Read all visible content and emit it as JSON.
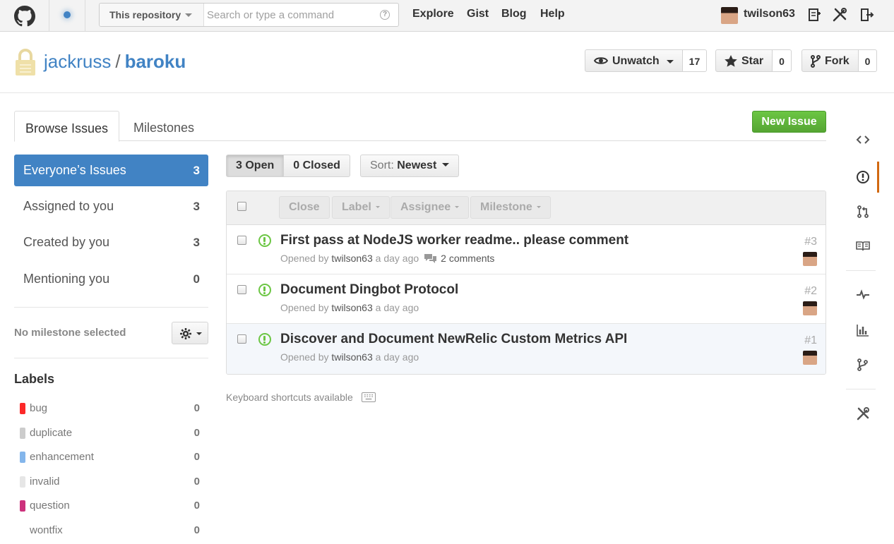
{
  "header": {
    "search_scope": "This repository",
    "search_placeholder": "Search or type a command",
    "nav": [
      "Explore",
      "Gist",
      "Blog",
      "Help"
    ],
    "username": "twilson63"
  },
  "repo": {
    "owner": "jackruss",
    "separator": "/",
    "name": "baroku",
    "watch_label": "Unwatch",
    "watch_count": "17",
    "star_label": "Star",
    "star_count": "0",
    "fork_label": "Fork",
    "fork_count": "0"
  },
  "tabs": [
    "Browse Issues",
    "Milestones"
  ],
  "new_issue_label": "New Issue",
  "filters": [
    {
      "label": "Everyone’s Issues",
      "count": "3"
    },
    {
      "label": "Assigned to you",
      "count": "3"
    },
    {
      "label": "Created by you",
      "count": "3"
    },
    {
      "label": "Mentioning you",
      "count": "0"
    }
  ],
  "milestone_text": "No milestone selected",
  "labels_heading": "Labels",
  "labels": [
    {
      "name": "bug",
      "count": "0",
      "color": "#fc2929"
    },
    {
      "name": "duplicate",
      "count": "0",
      "color": "#cccccc"
    },
    {
      "name": "enhancement",
      "count": "0",
      "color": "#84b6eb"
    },
    {
      "name": "invalid",
      "count": "0",
      "color": "#e6e6e6"
    },
    {
      "name": "question",
      "count": "0",
      "color": "#cc317c"
    },
    {
      "name": "wontfix",
      "count": "0",
      "color": "#ffffff"
    }
  ],
  "state": {
    "open": "3 Open",
    "closed": "0 Closed"
  },
  "sort": {
    "prefix": "Sort:",
    "value": "Newest"
  },
  "actions": [
    "Close",
    "Label",
    "Assignee",
    "Milestone"
  ],
  "issues": [
    {
      "title": "First pass at NodeJS worker readme.. please comment",
      "opened_by": "Opened by",
      "author": "twilson63",
      "age": "a day ago",
      "comments": "2 comments",
      "number": "#3"
    },
    {
      "title": "Document Dingbot Protocol",
      "opened_by": "Opened by",
      "author": "twilson63",
      "age": "a day ago",
      "comments": "",
      "number": "#2"
    },
    {
      "title": "Discover and Document NewRelic Custom Metrics API",
      "opened_by": "Opened by",
      "author": "twilson63",
      "age": "a day ago",
      "comments": "",
      "number": "#1"
    }
  ],
  "keyboard_text": "Keyboard shortcuts available",
  "colors": {
    "accent": "#4183c4",
    "green": "#6cc644",
    "rail_active": "#d26911"
  }
}
